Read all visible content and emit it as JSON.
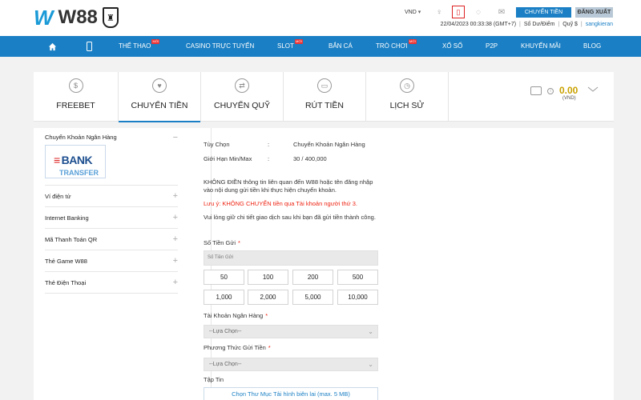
{
  "header": {
    "logo_text": "W88",
    "currency": "VND",
    "deposit_button": "CHUYỂN TIỀN",
    "logout_button": "ĐĂNG XUẤT",
    "datetime": "22/04/2023 00:33:38 (GMT+7)",
    "balance_label": "Số Dư/Điểm",
    "fund_label": "Quỹ $",
    "username": "sangkieran"
  },
  "nav": {
    "items": [
      {
        "label": "THỂ THAO",
        "badge": "MỚI"
      },
      {
        "label": "CASINO TRỰC TUYẾN",
        "badge": ""
      },
      {
        "label": "SLOT",
        "badge": "MỚI"
      },
      {
        "label": "BẮN CÁ",
        "badge": ""
      },
      {
        "label": "TRÒ CHƠI",
        "badge": "MỚI"
      },
      {
        "label": "XỔ SỐ",
        "badge": ""
      },
      {
        "label": "P2P",
        "badge": ""
      },
      {
        "label": "KHUYẾN MÃI",
        "badge": ""
      },
      {
        "label": "BLOG",
        "badge": ""
      }
    ]
  },
  "tabs": {
    "items": [
      {
        "label": "FREEBET",
        "icon": "$"
      },
      {
        "label": "CHUYỂN TIỀN",
        "icon": "♥"
      },
      {
        "label": "CHUYỂN QUỸ",
        "icon": "⇄"
      },
      {
        "label": "RÚT TIỀN",
        "icon": "▭"
      },
      {
        "label": "LỊCH SỬ",
        "icon": "◷"
      }
    ],
    "active_index": 1,
    "balance_value": "0.00",
    "balance_currency": "(VND)"
  },
  "sidebar": {
    "methods": [
      {
        "label": "Chuyển Khoản Ngân Hàng",
        "sign": "−"
      },
      {
        "label": "Ví điện tử",
        "sign": "+"
      },
      {
        "label": "Internet Banking",
        "sign": "+"
      },
      {
        "label": "Mã Thanh Toán QR",
        "sign": "+"
      },
      {
        "label": "Thẻ Game W88",
        "sign": "+"
      },
      {
        "label": "Thẻ Điện Thoại",
        "sign": "+"
      }
    ],
    "bank_logo_line1": "BANK",
    "bank_logo_line2": "TRANSFER"
  },
  "form": {
    "option_label": "Tùy Chọn",
    "option_value": "Chuyển Khoản Ngân Hàng",
    "limit_label": "Giới Hạn Min/Max",
    "limit_value": "30 / 400,000",
    "colon": ":",
    "notice": "KHÔNG ĐIỀN thông tin liên quan đến W88 hoặc tên đăng nhập vào nội dung gửi tiền khi thực hiện chuyển khoản.",
    "warning": "Lưu ý: KHÔNG CHUYỂN tiền qua Tài khoản người thứ 3.",
    "keep_info": "Vui lòng giữ chi tiết giao dịch sau khi bạn đã gửi tiền thành công.",
    "amount_label": "Số Tiền Gửi",
    "amount_placeholder": "Số Tiền Gửi",
    "required_mark": "*",
    "quick_amounts": [
      "50",
      "100",
      "200",
      "500",
      "1,000",
      "2,000",
      "5,000",
      "10,000"
    ],
    "bank_account_label": "Tài Khoản Ngân Hàng",
    "bank_account_value": "--Lựa Chọn--",
    "method_label": "Phương Thức Gửi Tiền",
    "method_value": "--Lựa Chọn--",
    "file_label": "Tập Tin",
    "upload_button": "Chọn Thư Mục Tải hình biên lai (max. 5 MB)"
  }
}
